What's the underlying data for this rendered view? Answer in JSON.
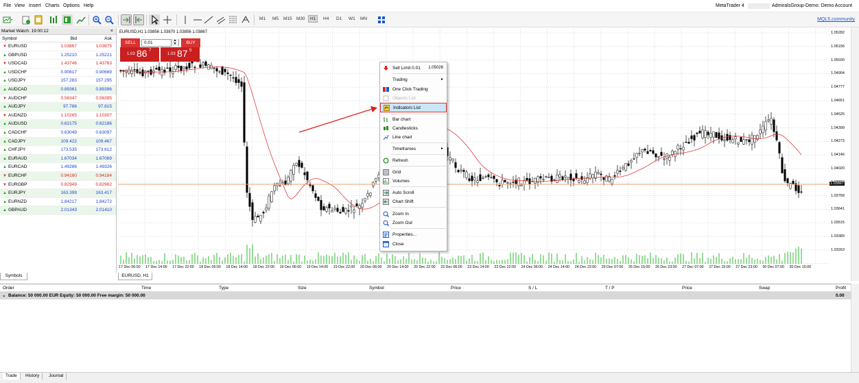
{
  "menu": [
    "File",
    "View",
    "Insert",
    "Charts",
    "Options",
    "Help"
  ],
  "window": {
    "app_name": "MetaTrader 4",
    "account": "AdmiralsGroup-Demo: Demo Account",
    "mql_link": "MQL5.community"
  },
  "timeframes": [
    "M1",
    "M5",
    "M15",
    "M30",
    "H1",
    "H4",
    "D1",
    "W1",
    "MN"
  ],
  "active_timeframe": "H1",
  "market_watch": {
    "title": "Market Watch: 19:00:12",
    "close_symbol": "×",
    "columns": {
      "symbol": "Symbol",
      "bid": "Bid",
      "ask": "Ask"
    },
    "rows": [
      {
        "symbol": "EURUSD",
        "bid": "1.03867",
        "ask": "1.03875",
        "dir": "down"
      },
      {
        "symbol": "GBPUSD",
        "bid": "1.25210",
        "ask": "1.25221",
        "dir": "up"
      },
      {
        "symbol": "USDCAD",
        "bid": "1.43746",
        "ask": "1.43763",
        "dir": "down"
      },
      {
        "symbol": "USDCHF",
        "bid": "0.90617",
        "ask": "0.90669",
        "dir": "up"
      },
      {
        "symbol": "USDJPY",
        "bid": "157.283",
        "ask": "157.295",
        "dir": "up"
      },
      {
        "symbol": "AUDCAD",
        "bid": "0.89361",
        "ask": "0.89396",
        "dir": "up"
      },
      {
        "symbol": "AUDCHF",
        "bid": "0.56347",
        "ask": "0.56395",
        "dir": "down"
      },
      {
        "symbol": "AUDJPY",
        "bid": "97.786",
        "ask": "97.815",
        "dir": "up"
      },
      {
        "symbol": "AUDNZD",
        "bid": "1.10265",
        "ask": "1.10307",
        "dir": "down"
      },
      {
        "symbol": "AUDUSD",
        "bid": "0.62175",
        "ask": "0.62186",
        "dir": "up"
      },
      {
        "symbol": "CADCHF",
        "bid": "0.63049",
        "ask": "0.63097",
        "dir": "up"
      },
      {
        "symbol": "CADJPY",
        "bid": "109.422",
        "ask": "109.467",
        "dir": "up"
      },
      {
        "symbol": "CHFJPY",
        "bid": "173.535",
        "ask": "173.612",
        "dir": "up"
      },
      {
        "symbol": "EURAUD",
        "bid": "1.67034",
        "ask": "1.67069",
        "dir": "up"
      },
      {
        "symbol": "EURCAD",
        "bid": "1.49286",
        "ask": "1.49326",
        "dir": "up"
      },
      {
        "symbol": "EURCHF",
        "bid": "0.94160",
        "ask": "0.94184",
        "dir": "down"
      },
      {
        "symbol": "EURGBP",
        "bid": "0.82949",
        "ask": "0.82962",
        "dir": "down"
      },
      {
        "symbol": "EURJPY",
        "bid": "163.399",
        "ask": "163.417",
        "dir": "up"
      },
      {
        "symbol": "EURNZD",
        "bid": "1.84217",
        "ask": "1.84272",
        "dir": "up"
      },
      {
        "symbol": "GBPAUD",
        "bid": "2.01343",
        "ask": "2.01410",
        "dir": "up"
      }
    ],
    "tab_label": "Symbols"
  },
  "chart": {
    "header": "EURUSD,H1  1.03856 1.03870 1.03856 1.03867",
    "tab_label": "EURUSD, H1",
    "current_price_label": "1.03867",
    "price_ticks": [
      "1.05282",
      "1.05156",
      "1.05030",
      "1.04904",
      "1.04777",
      "1.04651",
      "1.04525",
      "1.04399",
      "1.04273",
      "1.04146",
      "1.04020",
      "1.03894",
      "1.03768",
      "1.03641",
      "1.03515",
      "1.03389",
      "1.03263"
    ],
    "time_ticks": [
      "17 Dec 06:00",
      "17 Dec 14:00",
      "17 Dec 22:00",
      "18 Dec 06:00",
      "18 Dec 14:00",
      "18 Dec 22:00",
      "19 Dec 06:00",
      "19 Dec 14:00",
      "19 Dec 22:00",
      "20 Dec 06:00",
      "20 Dec 14:00",
      "20 Dec 22:00",
      "23 Dec 06:00",
      "23 Dec 14:00",
      "23 Dec 22:00",
      "24 Dec 06:00",
      "24 Dec 14:00",
      "24 Dec 22:00",
      "26 Dec 07:00",
      "26 Dec 15:00",
      "26 Dec 23:00",
      "27 Dec 07:00",
      "27 Dec 15:00",
      "27 Dec 23:00",
      "30 Dec 07:00",
      "30 Dec 15:00"
    ]
  },
  "one_click": {
    "sell_label": "SELL",
    "buy_label": "BUY",
    "lot": "0.01",
    "sell_small": "1.03",
    "sell_big": "86",
    "sell_sup": "7",
    "buy_small": "1.03",
    "buy_big": "87",
    "buy_sup": "5"
  },
  "context_menu": {
    "sell_limit": "Sell Limit 0.01",
    "sell_limit_price": "1.05026",
    "trading": "Trading",
    "one_click": "One Click Trading",
    "objects_list": "Objects List",
    "indicators_list": "Indicators List",
    "bar_chart": "Bar chart",
    "candlesticks": "Candlesticks",
    "line_chart": "Line chart",
    "timeframes": "Timeframes",
    "refresh": "Refresh",
    "grid": "Grid",
    "volumes": "Volumes",
    "auto_scroll": "Auto Scroll",
    "chart_shift": "Chart Shift",
    "zoom_in": "Zoom In",
    "zoom_out": "Zoom Out",
    "properties": "Properties...",
    "close": "Close",
    "submenu_arrow": "▸"
  },
  "terminal": {
    "columns": [
      "Order",
      "Time",
      "Type",
      "Size",
      "Symbol",
      "Price",
      "S / L",
      "T / P",
      "Price",
      "Swap",
      "Profit"
    ],
    "balance": "Balance: 50 000.00 EUR  Equity: 50 000.00  Free margin: 50 000.00",
    "profit_total": "0.00",
    "tabs": [
      "Trade",
      "History",
      "Journal"
    ]
  },
  "colors": {
    "up": "#18a818",
    "down": "#e02020",
    "bid_up": "#1a3fd6",
    "bid_down": "#e02020",
    "ma": "#e03a3a",
    "annotation": "#e02020"
  }
}
